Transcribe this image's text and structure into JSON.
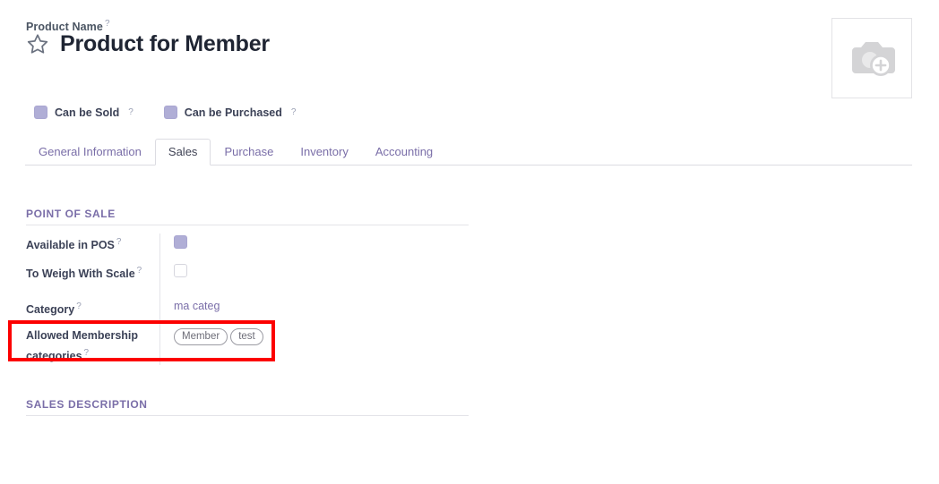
{
  "header": {
    "product_name_label": "Product Name",
    "help_marker": "?",
    "title": "Product for Member",
    "star_icon": "star-outline-icon",
    "image_placeholder_icon": "camera-add-photo-icon"
  },
  "booleans": [
    {
      "label": "Can be Sold",
      "checked": true,
      "name": "can-be-sold"
    },
    {
      "label": "Can be Purchased",
      "checked": true,
      "name": "can-be-purchased"
    }
  ],
  "tabs": [
    {
      "label": "General Information",
      "active": false
    },
    {
      "label": "Sales",
      "active": true
    },
    {
      "label": "Purchase",
      "active": false
    },
    {
      "label": "Inventory",
      "active": false
    },
    {
      "label": "Accounting",
      "active": false
    }
  ],
  "point_of_sale": {
    "title": "POINT OF SALE",
    "fields": {
      "available_in_pos": {
        "label": "Available in POS",
        "checked": true
      },
      "to_weigh_with_scale": {
        "label": "To Weigh With Scale",
        "checked": false
      },
      "category": {
        "label": "Category",
        "value": "ma categ"
      },
      "allowed_membership_categories": {
        "label": "Allowed Membership categories",
        "tags": [
          "Member",
          "test"
        ]
      }
    }
  },
  "sales_description": {
    "title": "SALES DESCRIPTION",
    "value": ""
  },
  "annotation": {
    "color": "#fc0000",
    "target": "allowed-membership-categories-row"
  },
  "colors": {
    "accent_purple": "#7a6ea8",
    "checkbox_checked": "#b0aed6",
    "text_dark": "#1f2533",
    "rule": "#e4e4e9",
    "highlight_red": "#fc0000"
  }
}
